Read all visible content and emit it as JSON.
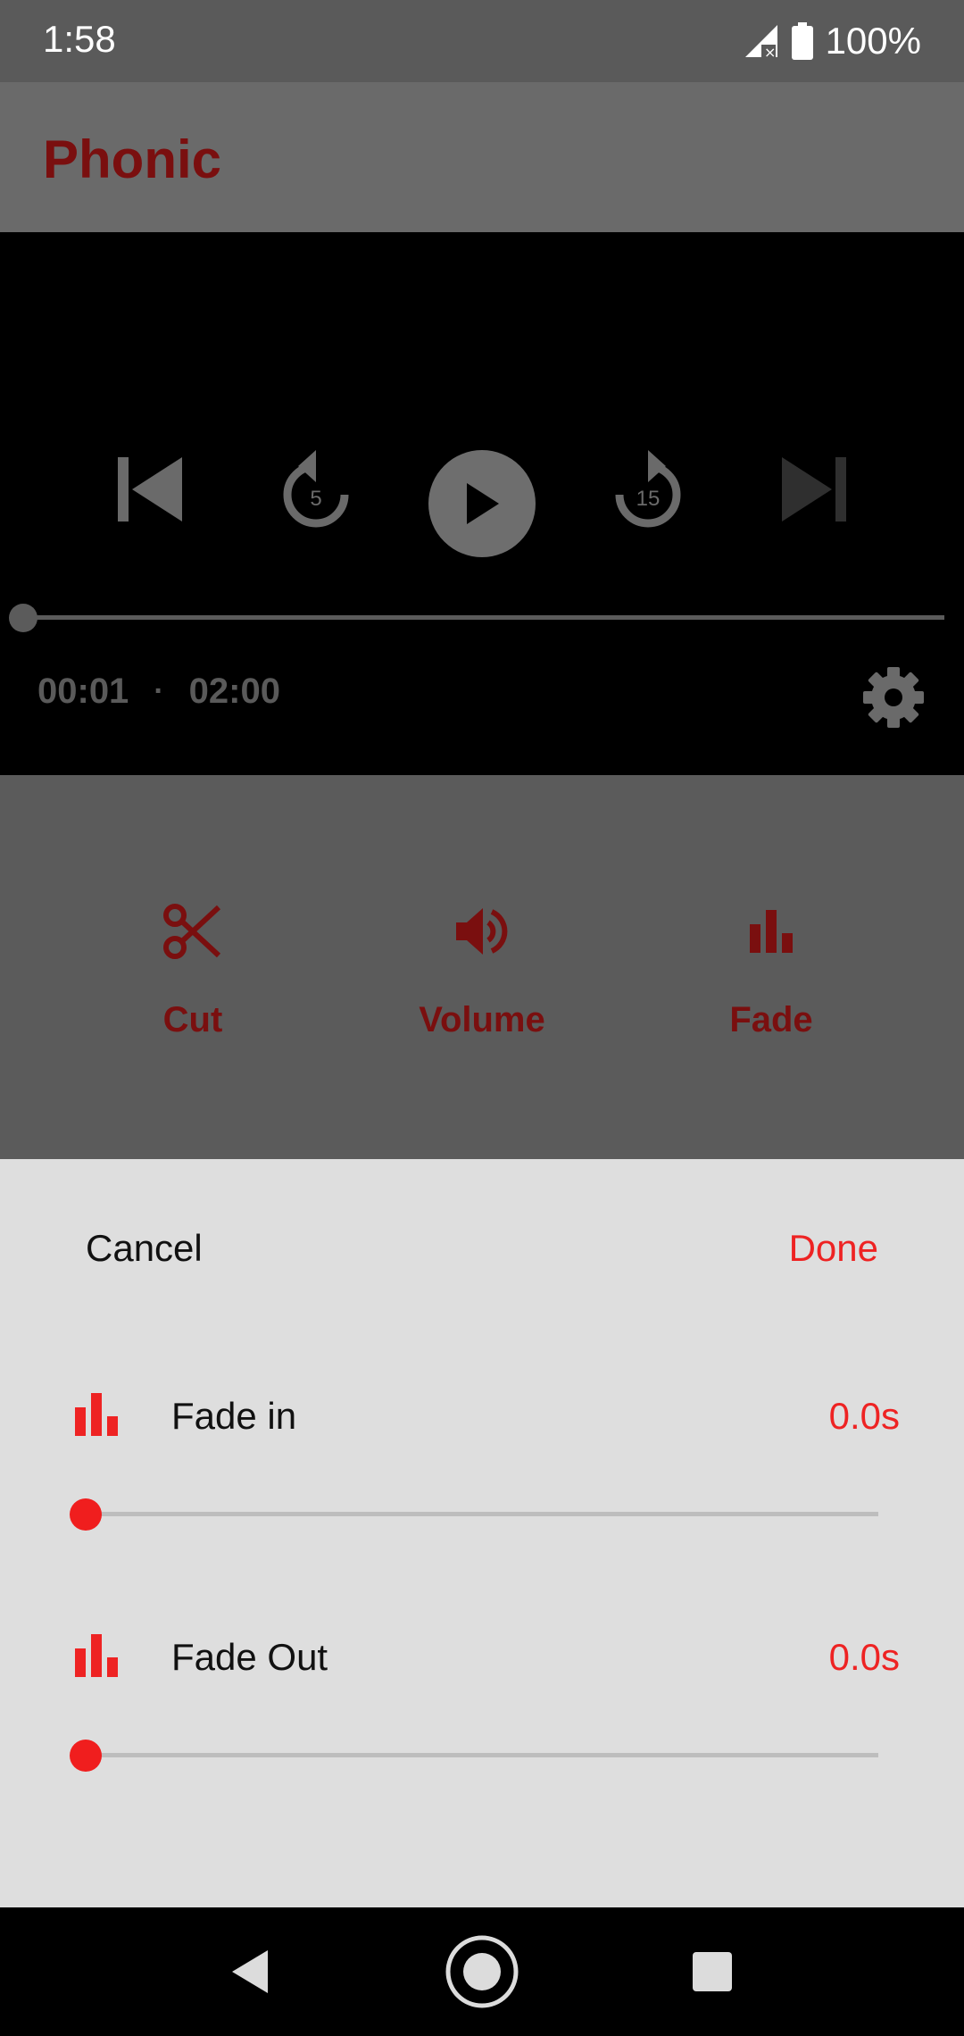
{
  "status_bar": {
    "time": "1:58",
    "battery": "100%",
    "icons": [
      "cellular-no-signal-icon",
      "battery-full-icon"
    ]
  },
  "app_bar": {
    "title": "Phonic"
  },
  "player": {
    "controls": [
      "skip-previous-icon",
      "replay-5-icon",
      "play-icon",
      "forward-15-icon",
      "skip-next-icon"
    ],
    "rewind_seconds": "5",
    "forward_seconds": "15",
    "position": "00:01",
    "separator": "·",
    "duration": "02:00",
    "seek_fraction": 0.0,
    "settings_icon": "gear-icon"
  },
  "tools": {
    "items": [
      {
        "label": "Cut",
        "icon": "scissors-icon"
      },
      {
        "label": "Volume",
        "icon": "volume-icon"
      },
      {
        "label": "Fade",
        "icon": "bar-chart-icon"
      }
    ]
  },
  "sheet": {
    "cancel_label": "Cancel",
    "done_label": "Done",
    "fade_in": {
      "label": "Fade in",
      "value": "0.0s",
      "fraction": 0.0
    },
    "fade_out": {
      "label": "Fade Out",
      "value": "0.0s",
      "fraction": 0.0
    }
  },
  "colors": {
    "accent": "#ee2323",
    "dim_accent": "#7a0f0f",
    "sheet_bg": "#dedede"
  }
}
